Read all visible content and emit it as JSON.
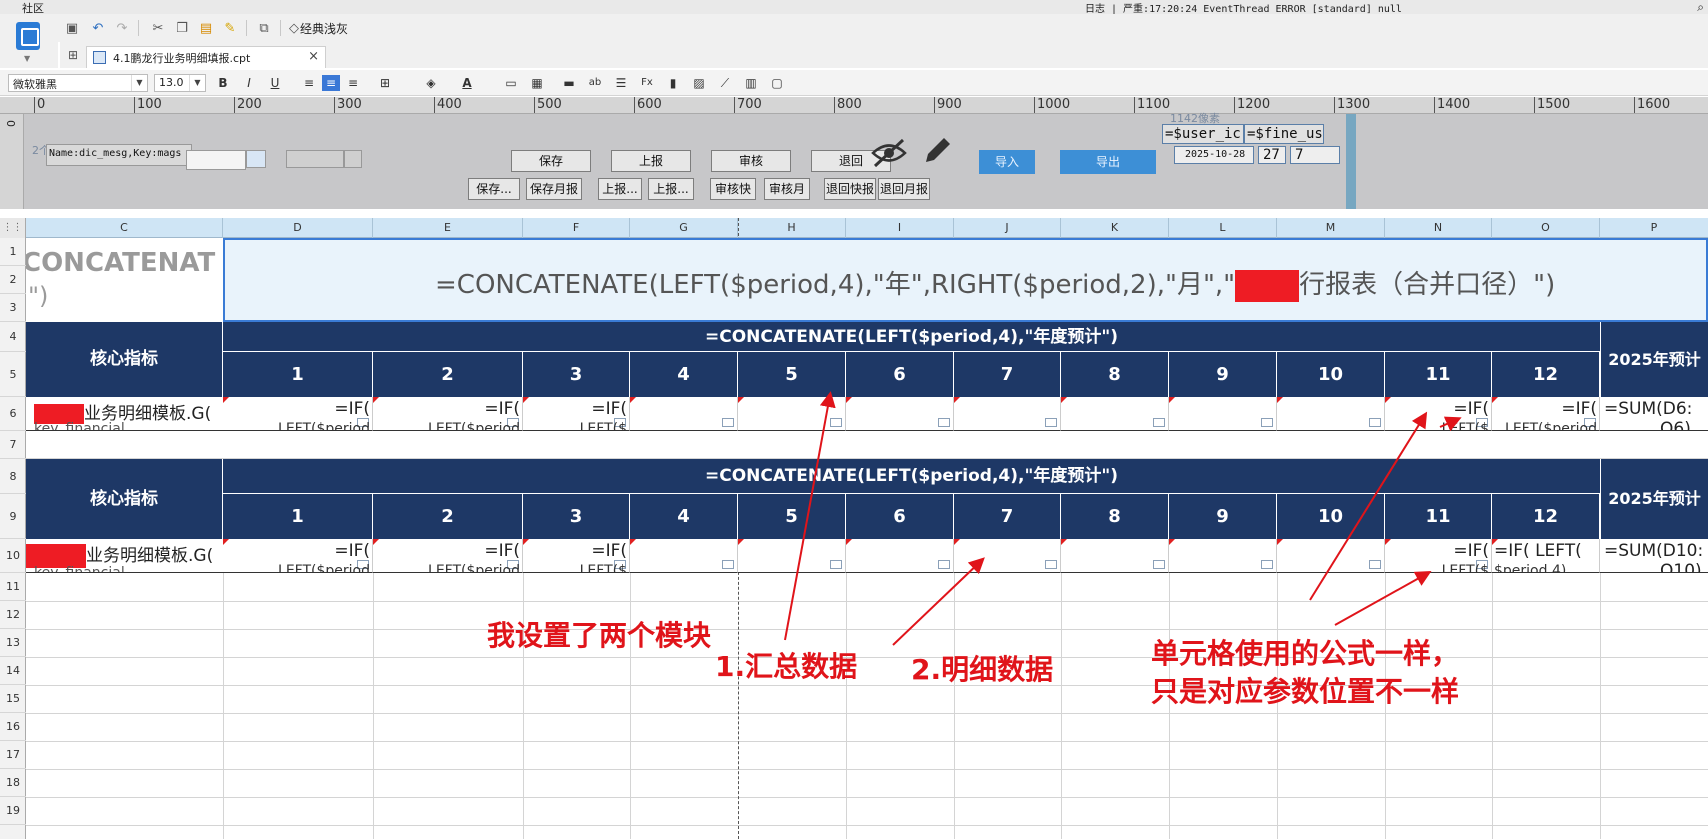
{
  "topbar": {
    "left": "社区",
    "log": "日志 | 严重:17:20:24 EventThread ERROR [standard] null",
    "search_icon": "search-icon"
  },
  "toolbar": {
    "classic_label": "经典浅灰",
    "tab_title": "4.1鹏龙行业务明细填报.cpt",
    "tab_close": "×",
    "tab_grid_icon": "⊞"
  },
  "format": {
    "font": "微软雅黑",
    "size": "13.0"
  },
  "ruler": {
    "ticks": [
      "0",
      "100",
      "200",
      "300",
      "400",
      "500",
      "600",
      "700",
      "800",
      "900",
      "1000",
      "1100",
      "1200",
      "1300",
      "1400",
      "1500",
      "1600"
    ],
    "v_tick": "0"
  },
  "param": {
    "label_gray": "2个元素",
    "name_field": "Name:dic_mesg,Key:mags",
    "buttons_row1": [
      "保存",
      "上报",
      "审核",
      "退回"
    ],
    "buttons_row2": [
      "保存...",
      "保存月报",
      "上报...",
      "上报...",
      "审核快",
      "审核月",
      "退回快报",
      "退回月报"
    ],
    "import": "导入",
    "export": "导出",
    "user_id": "=$user_ic",
    "fine_us": "=$fine_us",
    "pixel_label": "1142像素",
    "date": "2025-10-28",
    "day": "27",
    "num": "7"
  },
  "grid": {
    "columns": [
      "C",
      "D",
      "E",
      "F",
      "G",
      "H",
      "I",
      "J",
      "K",
      "L",
      "M",
      "N",
      "O",
      "P"
    ],
    "rows": [
      "1",
      "2",
      "3",
      "4",
      "5",
      "6",
      "7",
      "8",
      "9",
      "10",
      "11",
      "12",
      "13",
      "14",
      "15",
      "16",
      "17",
      "18",
      "19"
    ],
    "title_left": "CONCATENAT",
    "title_left2": "\")",
    "title_formula_a": "=CONCATENATE(LEFT($period,4),\"年\",RIGHT($period,2),\"月\",\"",
    "title_formula_b": "行报表（合并口径）\")",
    "block1": {
      "header_label": "核心指标",
      "year_formula": "=CONCATENATE(LEFT($period,4),\"年度预计\")",
      "months": [
        "1",
        "2",
        "3",
        "4",
        "5",
        "6",
        "7",
        "8",
        "9",
        "10",
        "11",
        "12"
      ],
      "year_total": "2025年预计",
      "row_label": "业务明细模板.G(",
      "row_label2": "key_financial",
      "formula_if": "=IF(",
      "formula_left": "LEFT($period",
      "formula_left_short": "LEFT($",
      "sum": "=SUM(D6:",
      "sum2": "O6)"
    },
    "block2": {
      "header_label": "核心指标",
      "year_formula": "=CONCATENATE(LEFT($period,4),\"年度预计\")",
      "months": [
        "1",
        "2",
        "3",
        "4",
        "5",
        "6",
        "7",
        "8",
        "9",
        "10",
        "11",
        "12"
      ],
      "year_total": "2025年预计",
      "row_label": "业务明细模板.G(",
      "row_label2": "key_financial",
      "formula_if": "=IF(",
      "formula_left": "LEFT($period",
      "formula_o": "=IF(    LEFT(",
      "formula_o2": "$period,4),",
      "sum": "=SUM(D10:",
      "sum2": "O10)"
    }
  },
  "annotations": {
    "two_modules": "我设置了两个模块",
    "summary": "1.汇总数据",
    "detail": "2.明细数据",
    "same_formula_1": "单元格使用的公式一样，",
    "same_formula_2": "只是对应参数位置不一样",
    "color": "#e0141a"
  }
}
